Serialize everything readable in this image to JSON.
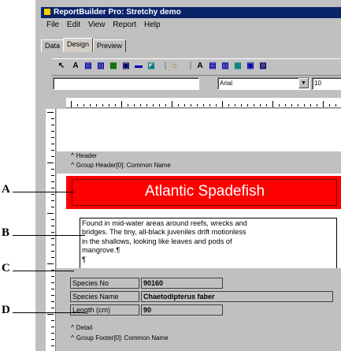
{
  "window": {
    "title": "ReportBuilder Pro: Stretchy demo"
  },
  "menu": [
    "File",
    "Edit",
    "View",
    "Report",
    "Help"
  ],
  "tabs": [
    {
      "label": "Data",
      "active": false
    },
    {
      "label": "Design",
      "active": true
    },
    {
      "label": "Preview",
      "active": false
    }
  ],
  "toolbar": {
    "font_name": "Arial",
    "font_size": "10"
  },
  "bands": {
    "header": "Header",
    "group_header": "Group Header[0]: Common Name",
    "detail": "Detail",
    "group_footer": "Group Footer[0]: Common Name"
  },
  "report": {
    "title": "Atlantic Spadefish",
    "description_lines": [
      "Found in mid-water areas around reefs, wrecks and",
      "bridges.  The tiny, all-black juveniles drift motionless",
      "in the shallows, looking like leaves and pods of",
      "mangrove.¶",
      "¶"
    ],
    "fields": [
      {
        "label": "Species No",
        "value": "90160"
      },
      {
        "label": "Species Name",
        "value": "Chaetodipterus faber"
      },
      {
        "label": "Length (cm)",
        "value": "90"
      }
    ]
  },
  "callouts": [
    "A",
    "B",
    "C",
    "D"
  ],
  "colors": {
    "title_band": "#ff0000",
    "title_text": "#ffffff",
    "titlebar": "#0a246a",
    "chrome": "#c0c0c0"
  }
}
